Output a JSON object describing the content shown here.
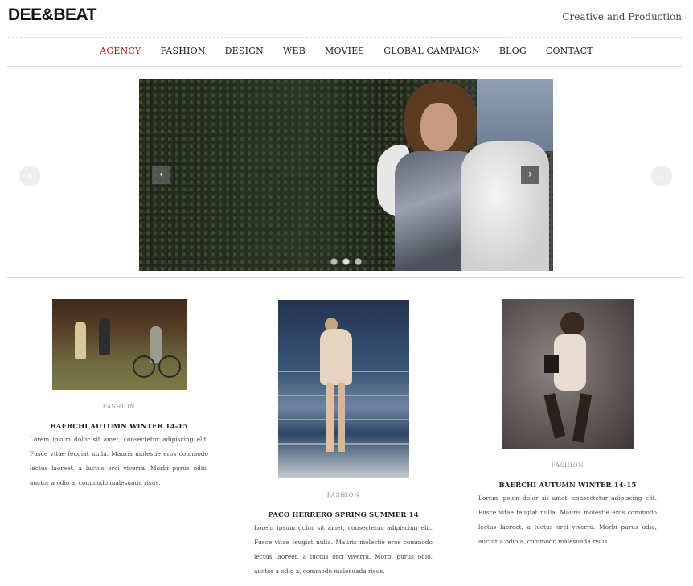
{
  "header": {
    "logo": "DEE&BEAT",
    "tagline": "Creative and Production"
  },
  "nav": {
    "items": [
      "AGENCY",
      "FASHION",
      "DESIGN",
      "WEB",
      "MOVIES",
      "GLOBAL CAMPAIGN",
      "BLOG",
      "CONTACT"
    ],
    "active": "AGENCY"
  },
  "slider": {
    "prev_icon": "‹",
    "next_icon": "›",
    "slide_count": 3,
    "active_slide": 1
  },
  "posts": [
    {
      "category": "FASHION",
      "title": "BAERCHI AUTUMN WINTER 14-15",
      "body": "Lorem ipsum dolor sit amet, consectetur adipiscing elit. Fusce vitae feugiat nulla. Mauris molestie eros commodo lectus laoreet, a luctus orci viverra. Morbi purus odio, auctor a odio a, commodo malesuada risus."
    },
    {
      "category": "FASHION",
      "title": "PACO HERRERO SPRING SUMMER 14",
      "body": "Lorem ipsum dolor sit amet, consectetur adipiscing elit. Fusce vitae feugiat nulla. Mauris molestie eros commodo lectus laoreet, a luctus orci viverra. Morbi purus odio, auctor a odio a, commodo malesuada risus."
    },
    {
      "category": "FASHION",
      "title": "BAERCHI AUTUMN WINTER 14-15",
      "body": "Lorem ipsum dolor sit amet, consectetur adipiscing elit. Fusce vitae feugiat nulla. Mauris molestie eros commodo lectus laoreet, a luctus orci viverra. Morbi purus odio, auctor a odio a, commodo malesuada risus."
    }
  ],
  "colors": {
    "accent": "#a8201a",
    "text": "#222222"
  }
}
